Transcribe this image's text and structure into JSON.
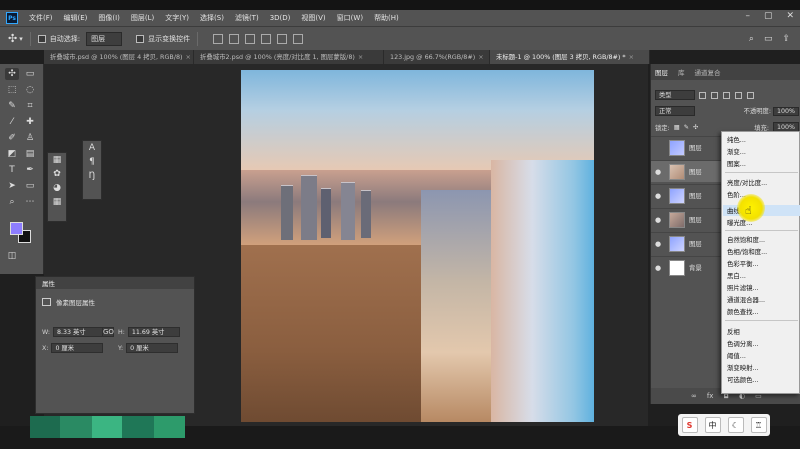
{
  "menubar": {
    "logo": "Ps",
    "items": [
      "文件(F)",
      "编辑(E)",
      "图像(I)",
      "图层(L)",
      "文字(Y)",
      "选择(S)",
      "滤镜(T)",
      "3D(D)",
      "视图(V)",
      "窗口(W)",
      "帮助(H)"
    ]
  },
  "options": {
    "auto_select_label": "自动选择:",
    "auto_select_value": "图层",
    "show_transform_label": "显示变换控件"
  },
  "tabs": [
    {
      "label": "折叠城市.psd @ 100% (图层 4 拷贝, RGB/8)",
      "active": false
    },
    {
      "label": "折叠城市2.psd @ 100% (亮度/对比度 1, 图层蒙版/8)",
      "active": false
    },
    {
      "label": "123.jpg @ 66.7%(RGB/8#)",
      "active": false
    },
    {
      "label": "未标题-1 @ 100% (图层 3 拷贝, RGB/8#) *",
      "active": true
    }
  ],
  "properties": {
    "tab_label": "属性",
    "title": "像素图层属性",
    "w_label": "W:",
    "w_value": "8.33 英寸",
    "h_label": "H:",
    "h_value": "11.69 英寸",
    "x_label": "X:",
    "x_value": "0 厘米",
    "y_label": "Y:",
    "y_value": "0 厘米",
    "link_glyph": "GO"
  },
  "layers": {
    "tabs": [
      "图层",
      "库",
      "通道复合"
    ],
    "kind_label": "类型",
    "blend_mode": "正常",
    "opacity_label": "不透明度:",
    "opacity_value": "100%",
    "lock_label": "锁定:",
    "fill_label": "填充:",
    "fill_value": "100%",
    "items": [
      {
        "name": "图层",
        "selected": false,
        "visible": false
      },
      {
        "name": "图层",
        "selected": true,
        "visible": true
      },
      {
        "name": "图层",
        "selected": false,
        "visible": true
      },
      {
        "name": "图层",
        "selected": false,
        "visible": true
      },
      {
        "name": "图层",
        "selected": false,
        "visible": true
      },
      {
        "name": "背景",
        "selected": false,
        "visible": true
      }
    ]
  },
  "adjustment_menu": {
    "items": [
      [
        "纯色...",
        "渐变...",
        "图案..."
      ],
      [
        "亮度/对比度...",
        "色阶...",
        "曲线...",
        "曝光度..."
      ],
      [
        "自然饱和度...",
        "色相/饱和度...",
        "色彩平衡...",
        "黑白...",
        "照片滤镜...",
        "通道混合器...",
        "颜色查找..."
      ],
      [
        "反相",
        "色调分离...",
        "阈值...",
        "渐变映射...",
        "可选颜色..."
      ]
    ],
    "highlighted": "曲线..."
  },
  "ime": {
    "s_label": "S",
    "zh_label": "中"
  },
  "colors": {
    "foreground": "#8d7dff",
    "background": "#111111",
    "accent": "#31a8ff",
    "highlight_cursor": "#fff200"
  }
}
